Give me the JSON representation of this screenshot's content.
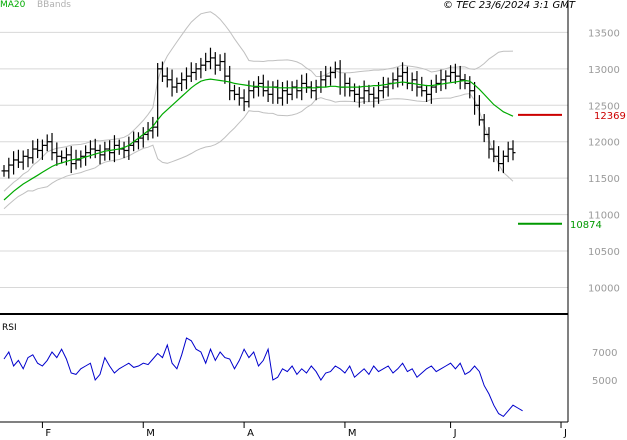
{
  "header": {
    "ma_label": "MA20",
    "bb_label": "BBands",
    "copyright": "© TEC 23/6/2024 3:1 GMT"
  },
  "colors": {
    "ma": "#00aa00",
    "bb": "#c0c0c0",
    "price": "#000000",
    "rsi": "#0000cc",
    "resistance": "#cc0000",
    "support": "#009900",
    "grid": "#d8d8d8"
  },
  "chart_data": [
    {
      "type": "bar",
      "title": "",
      "ylim": [
        9650,
        13780
      ],
      "y_ticks": [
        {
          "value": 13500,
          "label": "13500"
        },
        {
          "value": 13000,
          "label": "13000"
        },
        {
          "value": 12500,
          "label": "12500"
        },
        {
          "value": 12000,
          "label": "12000"
        },
        {
          "value": 11500,
          "label": "11500"
        },
        {
          "value": 11000,
          "label": "11000"
        },
        {
          "value": 10500,
          "label": "10500"
        },
        {
          "value": 10000,
          "label": "10000"
        }
      ],
      "x_ticks": [
        {
          "label": "F",
          "index": 8
        },
        {
          "label": "M",
          "index": 29
        },
        {
          "label": "A",
          "index": 50
        },
        {
          "label": "M",
          "index": 71
        },
        {
          "label": "J",
          "index": 93
        },
        {
          "label": "J",
          "index": 116
        }
      ],
      "levels": [
        {
          "name": "resistance",
          "value": 12369,
          "label": "12369"
        },
        {
          "name": "support",
          "value": 10874,
          "label": "10874"
        }
      ],
      "series": [
        {
          "type": "ohlc",
          "values": [
            11600,
            11680,
            11750,
            11720,
            11800,
            11780,
            11900,
            11880,
            11950,
            12000,
            11850,
            11800,
            11780,
            11820,
            11700,
            11750,
            11800,
            11850,
            11900,
            11880,
            11820,
            11900,
            11850,
            11950,
            11900,
            11880,
            11950,
            12000,
            12050,
            12100,
            12150,
            12200,
            13000,
            12900,
            12850,
            12750,
            12800,
            12850,
            12900,
            12950,
            13000,
            13050,
            13100,
            13150,
            13050,
            13100,
            12900,
            12700,
            12650,
            12600,
            12550,
            12700,
            12750,
            12800,
            12700,
            12650,
            12750,
            12600,
            12700,
            12650,
            12750,
            12700,
            12800,
            12750,
            12700,
            12750,
            12850,
            12900,
            12950,
            13000,
            12750,
            12800,
            12700,
            12650,
            12600,
            12700,
            12650,
            12600,
            12700,
            12750,
            12800,
            12850,
            12900,
            12950,
            12800,
            12850,
            12750,
            12700,
            12650,
            12750,
            12800,
            12850,
            12900,
            12950,
            12900,
            12850,
            12800,
            12700,
            12500,
            12300,
            12100,
            11900,
            11800,
            11700,
            11800,
            11900,
            11850
          ]
        },
        {
          "type": "line",
          "name": "MA20",
          "values": [
            11200,
            11260,
            11320,
            11370,
            11420,
            11460,
            11500,
            11540,
            11580,
            11620,
            11660,
            11690,
            11710,
            11730,
            11750,
            11760,
            11770,
            11790,
            11810,
            11830,
            11850,
            11870,
            11880,
            11890,
            11900,
            11920,
            11950,
            12000,
            12050,
            12100,
            12150,
            12210,
            12300,
            12380,
            12440,
            12500,
            12560,
            12620,
            12680,
            12740,
            12790,
            12830,
            12850,
            12860,
            12850,
            12840,
            12830,
            12820,
            12800,
            12790,
            12780,
            12770,
            12760,
            12760,
            12750,
            12750,
            12750,
            12740,
            12740,
            12740,
            12740,
            12740,
            12740,
            12740,
            12740,
            12740,
            12750,
            12750,
            12760,
            12760,
            12750,
            12750,
            12750,
            12750,
            12750,
            12760,
            12760,
            12770,
            12770,
            12780,
            12790,
            12800,
            12810,
            12820,
            12810,
            12800,
            12790,
            12780,
            12770,
            12770,
            12780,
            12790,
            12800,
            12810,
            12820,
            12830,
            12840,
            12830,
            12780,
            12720,
            12650,
            12580,
            12510,
            12460,
            12410,
            12380,
            12350
          ]
        }
      ]
    },
    {
      "type": "line",
      "title": "RSI",
      "ylim": [
        20,
        95
      ],
      "y_ticks": [
        {
          "value": 70,
          "label": "7000"
        },
        {
          "value": 50,
          "label": "5000"
        }
      ],
      "series": [
        {
          "name": "RSI",
          "values": [
            65,
            70,
            60,
            64,
            58,
            66,
            68,
            62,
            60,
            64,
            70,
            66,
            72,
            65,
            55,
            54,
            58,
            60,
            62,
            50,
            54,
            66,
            60,
            55,
            58,
            60,
            62,
            59,
            60,
            62,
            61,
            65,
            69,
            66,
            75,
            62,
            58,
            68,
            80,
            78,
            72,
            70,
            62,
            72,
            64,
            70,
            66,
            65,
            58,
            64,
            72,
            66,
            70,
            60,
            64,
            72,
            50,
            52,
            58,
            56,
            60,
            54,
            58,
            55,
            60,
            56,
            50,
            55,
            56,
            60,
            58,
            55,
            60,
            52,
            55,
            58,
            54,
            60,
            56,
            58,
            60,
            55,
            58,
            62,
            56,
            58,
            52,
            55,
            58,
            60,
            56,
            58,
            60,
            62,
            58,
            62,
            54,
            56,
            60,
            56,
            46,
            40,
            32,
            26,
            24,
            28,
            32,
            30,
            28
          ]
        }
      ]
    }
  ]
}
